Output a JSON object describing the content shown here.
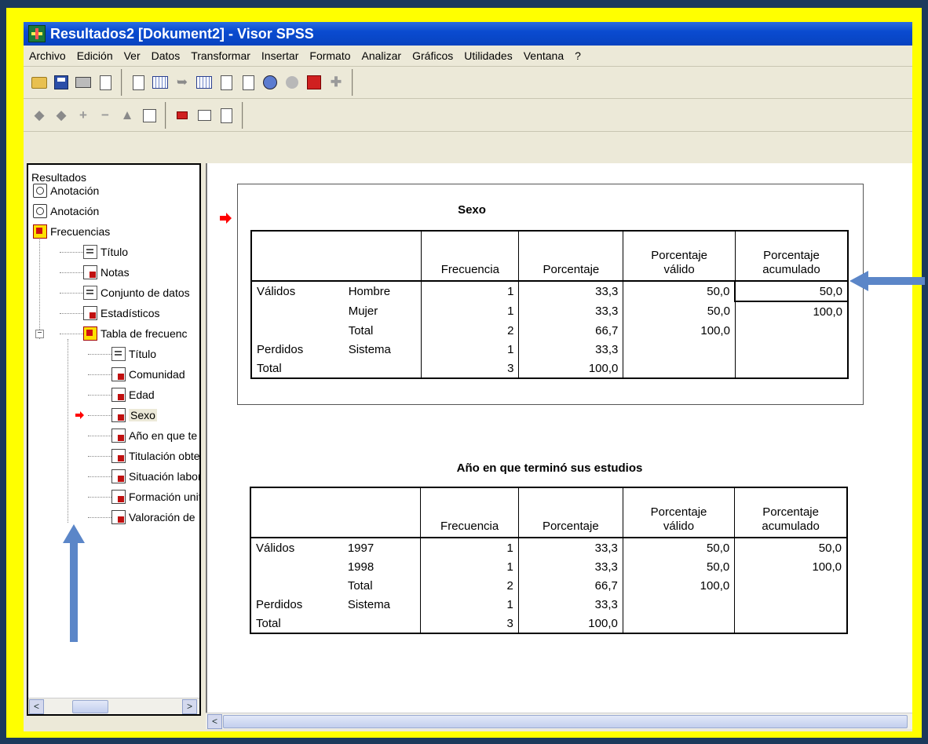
{
  "window": {
    "title": "Resultados2 [Dokument2] - Visor SPSS"
  },
  "menubar": {
    "items": [
      "Archivo",
      "Edición",
      "Ver",
      "Datos",
      "Transformar",
      "Insertar",
      "Formato",
      "Analizar",
      "Gráficos",
      "Utilidades",
      "Ventana",
      "?"
    ]
  },
  "toolbar1": {
    "icons": [
      "open-folder-icon",
      "save-icon",
      "print-icon",
      "print-preview-icon",
      "export-icon",
      "insert-table-icon",
      "undo-icon",
      "data-editor-icon",
      "go-to-case-icon",
      "help-cursor-icon",
      "designate-window-icon",
      "gray-circle-icon",
      "insert-heading-icon",
      "plus-icon"
    ]
  },
  "toolbar2": {
    "icons": [
      "back-icon",
      "forward-icon",
      "expand-icon",
      "collapse-icon",
      "promote-icon",
      "box-icon",
      "insert-text-icon",
      "insert-title-icon",
      "insert-output-icon"
    ]
  },
  "outline": {
    "root": "Resultados",
    "items": [
      {
        "label": "Anotación",
        "icon": "annotation-icon"
      },
      {
        "label": "Anotación",
        "icon": "annotation-icon"
      },
      {
        "label": "Frecuencias",
        "icon": "procedure-icon"
      },
      {
        "label": "Título",
        "icon": "title-icon"
      },
      {
        "label": "Notas",
        "icon": "notes-icon"
      },
      {
        "label": "Conjunto de datos",
        "icon": "dataset-icon"
      },
      {
        "label": "Estadísticos",
        "icon": "table-icon"
      },
      {
        "label": "Tabla de frecuenc",
        "icon": "procedure-icon"
      },
      {
        "label": "Título",
        "icon": "title-icon"
      },
      {
        "label": "Comunidad",
        "icon": "table-icon"
      },
      {
        "label": "Edad",
        "icon": "table-icon"
      },
      {
        "label": "Sexo",
        "icon": "table-icon"
      },
      {
        "label": "Año en que te",
        "icon": "table-icon"
      },
      {
        "label": "Titulación obte",
        "icon": "table-icon"
      },
      {
        "label": "Situación labor",
        "icon": "table-icon"
      },
      {
        "label": "Formación unit",
        "icon": "table-icon"
      },
      {
        "label": "Valoración de",
        "icon": "table-icon"
      }
    ],
    "selected_index": 11
  },
  "tables": [
    {
      "title": "Sexo",
      "headers": [
        "Frecuencia",
        "Porcentaje",
        "Porcentaje válido",
        "Porcentaje acumulado"
      ],
      "header_lines": [
        [
          "Frecuencia"
        ],
        [
          "Porcentaje"
        ],
        [
          "Porcentaje",
          "válido"
        ],
        [
          "Porcentaje",
          "acumulado"
        ]
      ],
      "rows": [
        {
          "group": "Válidos",
          "label": "Hombre",
          "frecuencia": "1",
          "porcentaje": "33,3",
          "valido": "50,0",
          "acumulado": "50,0"
        },
        {
          "group": "",
          "label": "Mujer",
          "frecuencia": "1",
          "porcentaje": "33,3",
          "valido": "50,0",
          "acumulado": "100,0"
        },
        {
          "group": "",
          "label": "Total",
          "frecuencia": "2",
          "porcentaje": "66,7",
          "valido": "100,0",
          "acumulado": ""
        },
        {
          "group": "Perdidos",
          "label": "Sistema",
          "frecuencia": "1",
          "porcentaje": "33,3",
          "valido": "",
          "acumulado": ""
        },
        {
          "group": "Total",
          "label": "",
          "frecuencia": "3",
          "porcentaje": "100,0",
          "valido": "",
          "acumulado": ""
        }
      ]
    },
    {
      "title": "Año en que terminó sus estudios",
      "header_lines": [
        [
          "Frecuencia"
        ],
        [
          "Porcentaje"
        ],
        [
          "Porcentaje",
          "válido"
        ],
        [
          "Porcentaje",
          "acumulado"
        ]
      ],
      "rows": [
        {
          "group": "Válidos",
          "label": "1997",
          "frecuencia": "1",
          "porcentaje": "33,3",
          "valido": "50,0",
          "acumulado": "50,0"
        },
        {
          "group": "",
          "label": "1998",
          "frecuencia": "1",
          "porcentaje": "33,3",
          "valido": "50,0",
          "acumulado": "100,0"
        },
        {
          "group": "",
          "label": "Total",
          "frecuencia": "2",
          "porcentaje": "66,7",
          "valido": "100,0",
          "acumulado": ""
        },
        {
          "group": "Perdidos",
          "label": "Sistema",
          "frecuencia": "1",
          "porcentaje": "33,3",
          "valido": "",
          "acumulado": ""
        },
        {
          "group": "Total",
          "label": "",
          "frecuencia": "3",
          "porcentaje": "100,0",
          "valido": "",
          "acumulado": ""
        }
      ]
    }
  ],
  "colors": {
    "frame": "#ffff00",
    "background": "#1b3a5c",
    "titlebar": "#0a4bd0",
    "annotation_arrow": "#5b86c8",
    "current_item_arrow": "#ff0000"
  },
  "scrollbar_glyphs": {
    "left": "<",
    "right": ">"
  }
}
